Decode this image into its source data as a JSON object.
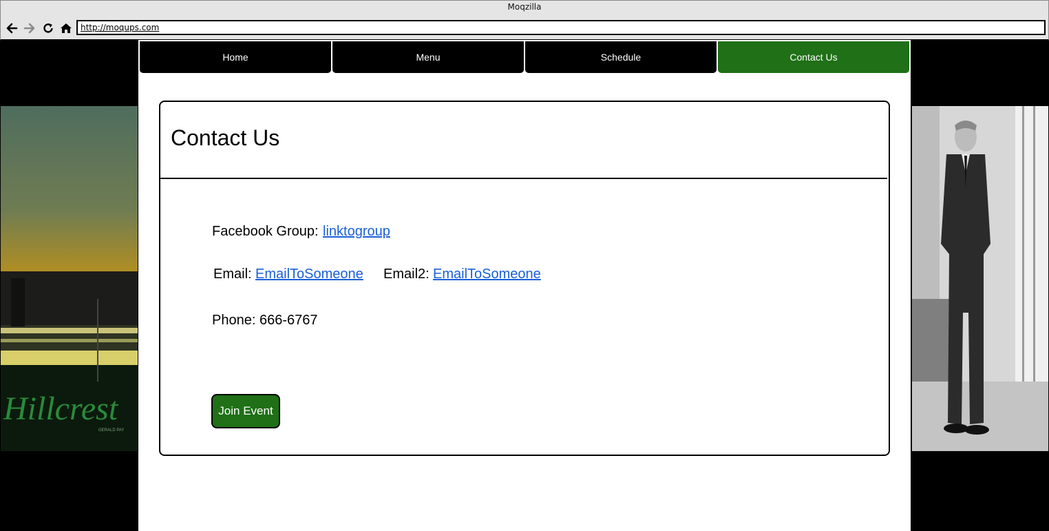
{
  "window": {
    "title": "Moqzilla",
    "url": "http://moqups.com"
  },
  "nav": {
    "tabs": [
      {
        "label": "Home"
      },
      {
        "label": "Menu"
      },
      {
        "label": "Schedule"
      },
      {
        "label": "Contact Us"
      }
    ]
  },
  "contact": {
    "title": "Contact Us",
    "facebook_label": "Facebook Group:",
    "facebook_link": "linktogroup",
    "email_label": "Email:",
    "email_link": "EmailToSomeone",
    "email2_label": "Email2:",
    "email2_link": "EmailToSomeone",
    "phone": "Phone: 666-6767",
    "join_button": "Join Event"
  },
  "images": {
    "left_script_text": "Hillcrest",
    "left_caption": "GERALD PAY"
  },
  "colors": {
    "active_tab": "#1f7017",
    "link": "#1a5fd8",
    "join_button": "#1f7017"
  }
}
